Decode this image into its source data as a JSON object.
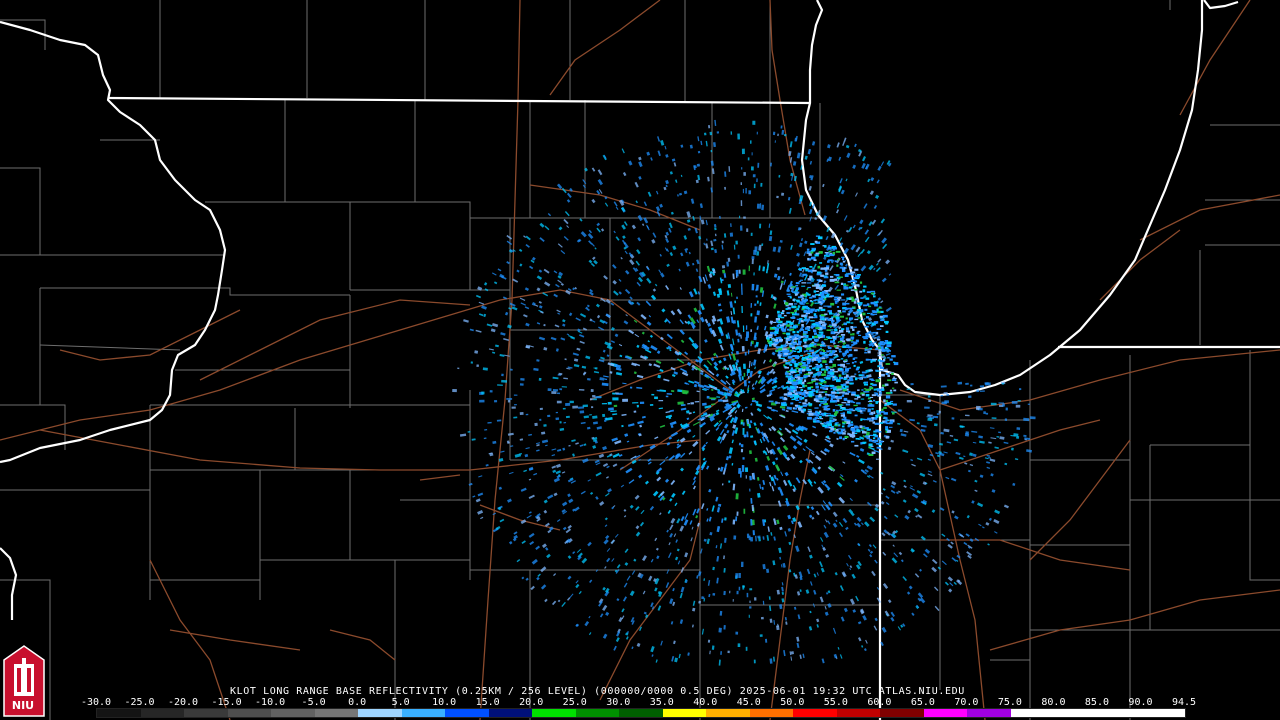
{
  "caption": "KLOT LONG RANGE BASE REFLECTIVITY (0.25KM / 256 LEVEL) (000000/0000 0.5 DEG) 2025-06-01 19:32 UTC  ATLAS.NIU.EDU",
  "logo": {
    "text": "NIU",
    "icon": "niu-tower-logo-icon"
  },
  "colors": {
    "background": "#000000",
    "state_border": "#ffffff",
    "county_border": "#8a8a8a",
    "highway": "#8b4a2c",
    "echo_light": "#7fb8ff",
    "echo_medium": "#1e90ff",
    "echo_strong": "#00c8ff",
    "echo_green": "#20c040"
  },
  "scale": {
    "labels": [
      "-30.0",
      "-25.0",
      "-20.0",
      "-15.0",
      "-10.0",
      "-5.0",
      "0.0",
      "5.0",
      "10.0",
      "15.0",
      "20.0",
      "25.0",
      "30.0",
      "35.0",
      "40.0",
      "45.0",
      "50.0",
      "55.0",
      "60.0",
      "65.0",
      "70.0",
      "75.0",
      "80.0",
      "85.0",
      "90.0",
      "94.5"
    ],
    "colors": [
      "#141414",
      "#262626",
      "#3a3a3a",
      "#4e4e4e",
      "#626262",
      "#767676",
      "#9fd5ff",
      "#3ab0ff",
      "#0050ff",
      "#00107a",
      "#00e000",
      "#009000",
      "#006000",
      "#ffff00",
      "#ffb000",
      "#ff7000",
      "#ff0000",
      "#c00000",
      "#800000",
      "#ff00ff",
      "#a000e0",
      "#ffffff",
      "#ffffff",
      "#ffffff",
      "#ffffff"
    ]
  }
}
